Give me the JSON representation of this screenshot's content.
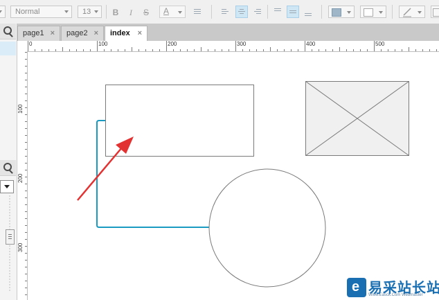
{
  "toolbar": {
    "font_style": "Normal",
    "font_size": "13",
    "bold_glyph": "B",
    "italic_glyph": "I",
    "underline_glyph": "S",
    "font_color_glyph": "A",
    "bullets_icon": "bullet-list-icon",
    "align_left_icon": "align-left-icon",
    "align_center_icon": "align-center-icon",
    "align_right_icon": "align-right-icon",
    "valign_top_icon": "align-top-icon",
    "valign_middle_icon": "align-middle-icon",
    "valign_bottom_icon": "align-bottom-icon",
    "fill_color": "#5a9fd0",
    "border_color": "#cccccc",
    "accent_active": "#cfe6f5"
  },
  "tabs": [
    {
      "label": "page1",
      "close": "×",
      "active": false
    },
    {
      "label": "page2",
      "close": "×",
      "active": false
    },
    {
      "label": "index",
      "close": "×",
      "active": true
    }
  ],
  "ruler": {
    "top_labels": [
      "0",
      "100",
      "200",
      "300",
      "400",
      "500"
    ],
    "left_labels": [
      "100",
      "200",
      "300"
    ]
  },
  "canvas": {
    "connector_color": "#1a9ac0",
    "arrow_color": "#e33232",
    "shape_border": "#7a7a7a",
    "placeholder_fill": "#f0f0f0"
  },
  "watermark": {
    "name": "易采站长站",
    "sub": "Www.Easck.Com Webmaster"
  }
}
